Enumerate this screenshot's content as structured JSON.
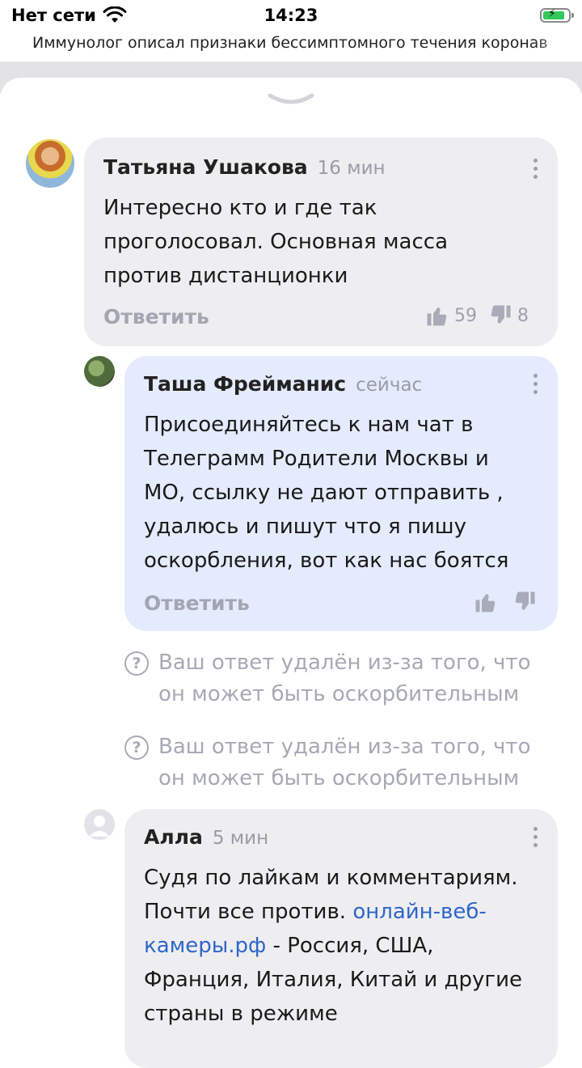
{
  "status_bar": {
    "network": "Нет сети",
    "time": "14:23"
  },
  "article_title": "Иммунолог описал признаки бессимптомного течения коронав",
  "comments": [
    {
      "author": "Татьяна Ушакова",
      "time": "16 мин",
      "text": "Интересно кто и где так проголосовал. Основная масса против дистанционки",
      "reply_label": "Ответить",
      "likes": "59",
      "dislikes": "8",
      "avatar_color": "#c9a34e"
    },
    {
      "author": "Таша Фрейманис",
      "time": "сейчас",
      "text": "Присоединяйтесь к нам чат в Телеграмм Родители Москвы и МО, ссылку не дают отправить , удалюсь и пишут что я пишу оскорбления, вот как нас боятся",
      "reply_label": "Ответить",
      "avatar_color": "#4f6b3c"
    }
  ],
  "deleted_notices": [
    "Ваш ответ удалён из-за того, что он может быть оскорбительным",
    "Ваш ответ удалён из-за того, что он может быть оскорбительным"
  ],
  "third_comment": {
    "author": "Алла",
    "time": "5 мин",
    "text_before_link": "Судя по лайкам и комментариям. Почти все против.",
    "link": "онлайн-веб-камеры.рф",
    "text_after_link": " - Россия, США, Франция, Италия, Китай и другие страны в режиме"
  },
  "colors": {
    "accent_link": "#2f66c9",
    "bubble_gray": "#eeeef1",
    "bubble_blue": "#e4ebfc",
    "muted_text": "#9a9ba6"
  }
}
